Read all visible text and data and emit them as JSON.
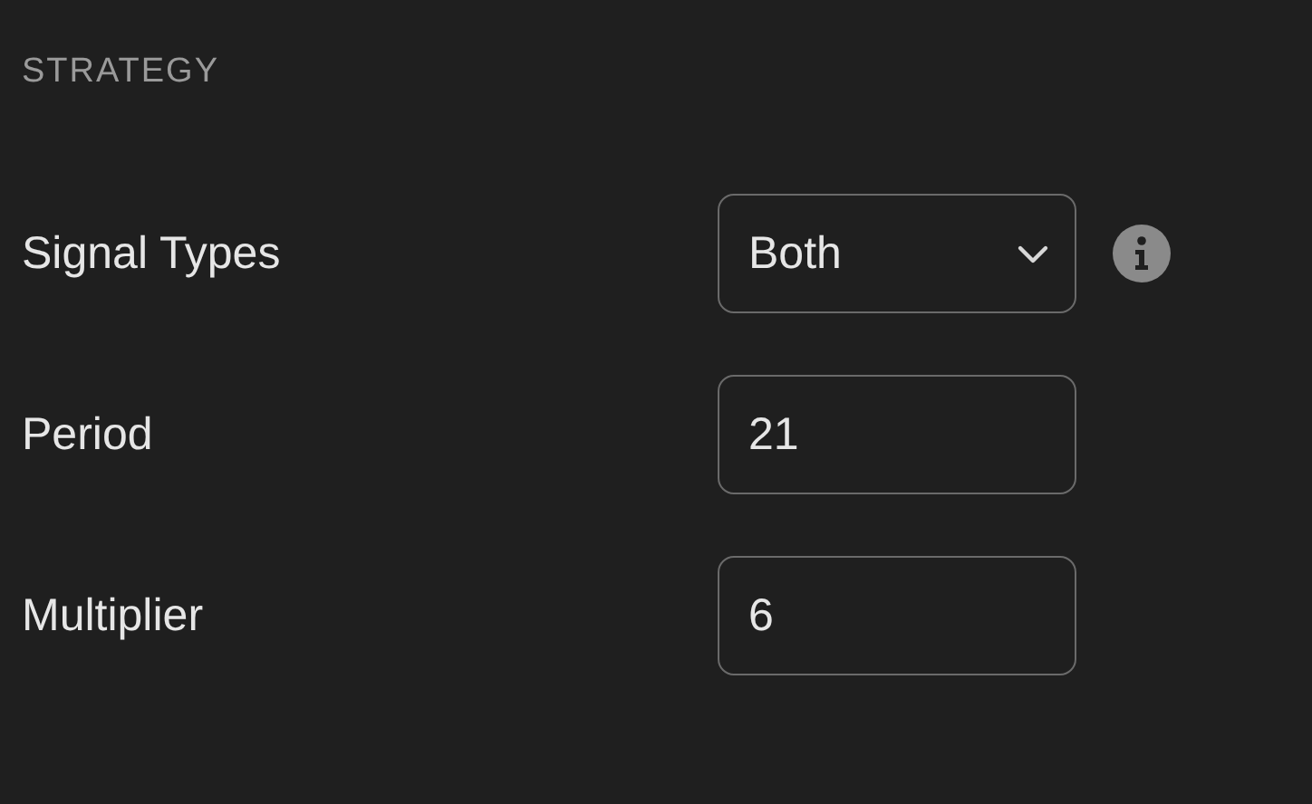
{
  "section": {
    "title": "STRATEGY"
  },
  "fields": [
    {
      "label": "Signal Types",
      "kind": "select",
      "value": "Both",
      "info": true
    },
    {
      "label": "Period",
      "kind": "number",
      "value": "21"
    },
    {
      "label": "Multiplier",
      "kind": "number",
      "value": "6"
    }
  ]
}
